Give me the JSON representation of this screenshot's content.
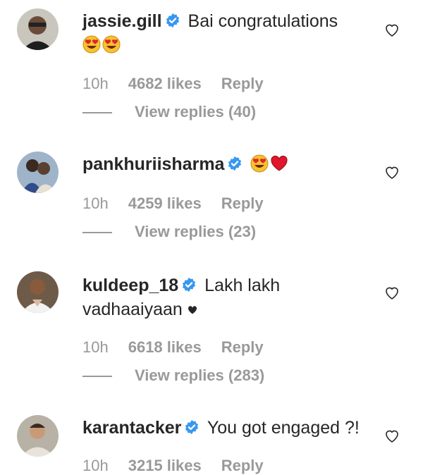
{
  "comments": [
    {
      "username": "jassie.gill",
      "text": "Bai congratulations",
      "emojis": [
        "heart-eyes-emoji",
        "heart-eyes-emoji"
      ],
      "time": "10h",
      "likes": "4682 likes",
      "reply": "Reply",
      "view_replies": "View replies (40)"
    },
    {
      "username": "pankhuriisharma",
      "text": "",
      "emojis": [
        "heart-eyes-emoji",
        "red-heart-emoji"
      ],
      "time": "10h",
      "likes": "4259 likes",
      "reply": "Reply",
      "view_replies": "View replies (23)"
    },
    {
      "username": "kuldeep_18",
      "text": "Lakh lakh",
      "text2": "vadhaaiyaan",
      "emojis": [
        "black-heart-emoji"
      ],
      "time": "10h",
      "likes": "6618 likes",
      "reply": "Reply",
      "view_replies": "View replies (283)"
    },
    {
      "username": "karantacker",
      "text": "You got engaged ?!",
      "emojis": [],
      "time": "10h",
      "likes": "3215 likes",
      "reply": "Reply",
      "view_replies": ""
    }
  ],
  "colors": {
    "verified": "#3897f0",
    "muted": "#999999",
    "text": "#262626"
  }
}
